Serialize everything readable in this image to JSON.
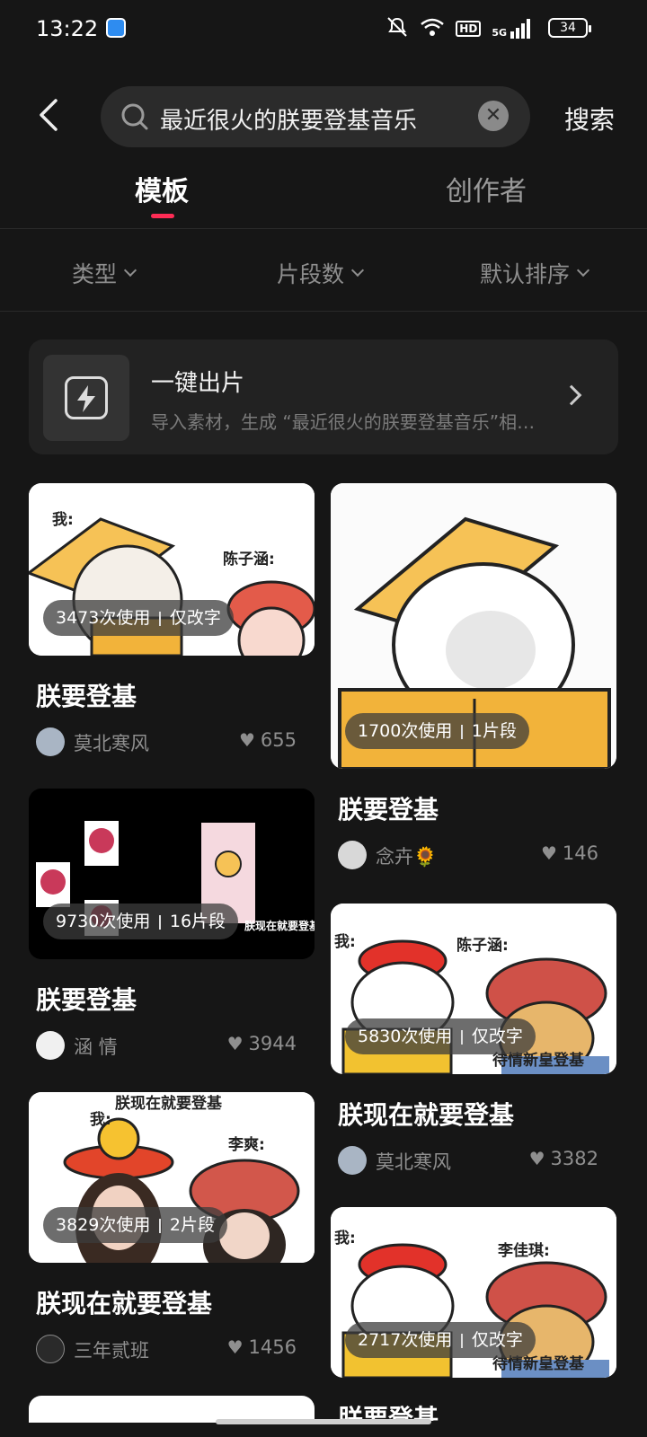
{
  "status": {
    "time": "13:22",
    "hd": "HD",
    "net": "5G",
    "battery": "34"
  },
  "search": {
    "query": "最近很火的朕要登基音乐",
    "button": "搜索"
  },
  "tabs": [
    {
      "label": "模板"
    },
    {
      "label": "创作者"
    }
  ],
  "filters": [
    {
      "label": "类型"
    },
    {
      "label": "片段数"
    },
    {
      "label": "默认排序"
    }
  ],
  "oneclick": {
    "title": "一键出片",
    "subtitle": "导入素材，生成 “最近很火的朕要登基音乐”相关视频"
  },
  "cards": [
    {
      "title": "朕要登基",
      "usage": "3473次使用",
      "info": "仅改字",
      "author": "莫北寒风",
      "likes": "655",
      "caption_a": "我:",
      "caption_b": "陈子涵:"
    },
    {
      "title": "朕要登基",
      "usage": "1700次使用",
      "info": "1片段",
      "author": "念卉🌻",
      "likes": "146"
    },
    {
      "title": "朕要登基",
      "usage": "9730次使用",
      "info": "16片段",
      "author": "涵 情",
      "likes": "3944",
      "caption_a": "朕现在就要登基"
    },
    {
      "title": "朕现在就要登基",
      "usage": "5830次使用",
      "info": "仅改字",
      "author": "莫北寒风",
      "likes": "3382",
      "caption_a": "我:",
      "caption_b": "陈子涵:",
      "caption_c": "待情新皇登基"
    },
    {
      "title": "朕现在就要登基",
      "usage": "3829次使用",
      "info": "2片段",
      "author": "三年贰班",
      "likes": "1456",
      "caption_a": "我:",
      "caption_b": "李爽:",
      "caption_c": "朕现在就要登基"
    },
    {
      "title": "朕要登基",
      "usage": "2717次使用",
      "info": "仅改字",
      "author": "",
      "likes": "",
      "caption_a": "我:",
      "caption_b": "李佳琪:",
      "caption_c": "待情新皇登基"
    }
  ]
}
